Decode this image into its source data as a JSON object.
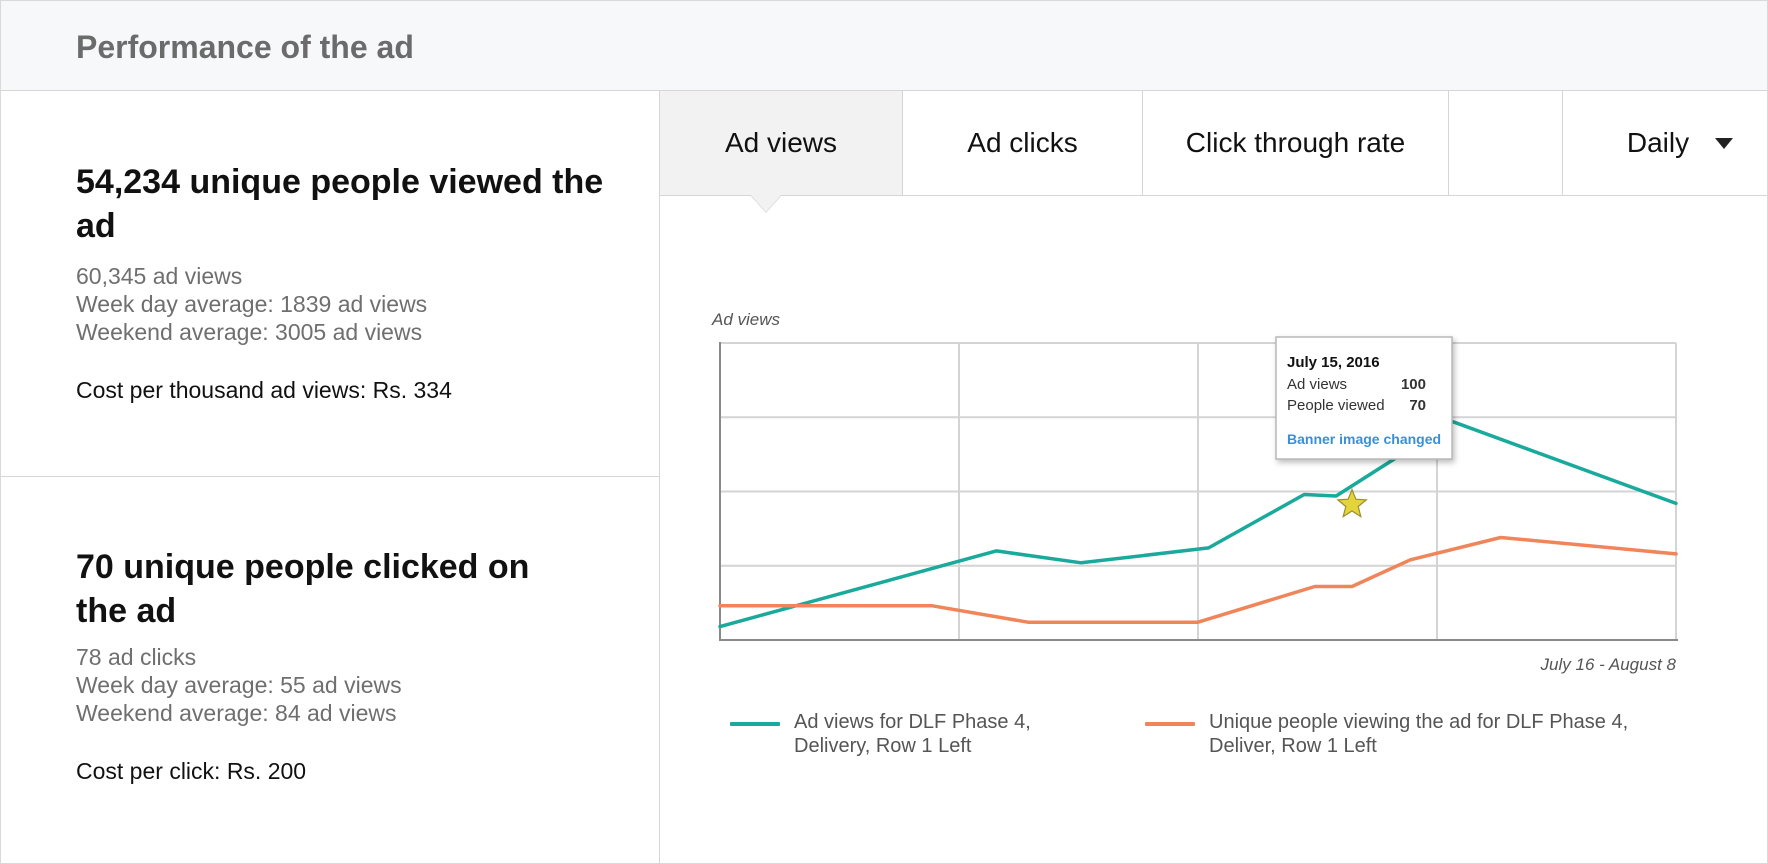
{
  "header": {
    "title": "Performance of the ad"
  },
  "views_summary": {
    "headline": "54,234 unique people viewed the ad",
    "lines": [
      "60,345 ad views",
      "Week day average: 1839 ad views",
      "Weekend average: 3005 ad views"
    ],
    "cost": "Cost per thousand ad views: Rs. 334"
  },
  "clicks_summary": {
    "headline": "70 unique people clicked on the ad",
    "lines": [
      "78 ad clicks",
      "Week day average: 55 ad views",
      "Weekend average: 84 ad views"
    ],
    "cost": "Cost per click: Rs. 200"
  },
  "tabs": [
    {
      "label": "Ad views",
      "active": true
    },
    {
      "label": "Ad clicks",
      "active": false
    },
    {
      "label": "Click through rate",
      "active": false
    },
    {
      "label": "",
      "active": false
    }
  ],
  "period_select": {
    "value": "Daily"
  },
  "colors": {
    "views": "#1aaa9c",
    "people": "#f0855a",
    "star": "#e4d43c",
    "link": "#3a8fd8"
  },
  "chart_data": {
    "type": "line",
    "ylabel": "Ad views",
    "xlabel": "July 16 - August 8",
    "x": [
      0,
      1.2,
      1.7,
      2.05,
      2.6,
      3.15,
      3.8,
      4.5,
      4.65,
      5.0,
      5.7,
      6.7,
      7.9,
      9.0
    ],
    "xlim": [
      0,
      9
    ],
    "ylim": [
      0,
      200
    ],
    "grid": true,
    "legend_position": "bottom",
    "series": [
      {
        "name": "Ad views for DLF Phase 4, Delivery, Row 1 Left",
        "color": "#1aaa9c",
        "x": [
          0,
          2.6,
          3.4,
          4.6,
          5.5,
          5.8,
          6.9,
          9.0
        ],
        "values": [
          9,
          60,
          52,
          62,
          98,
          97,
          147,
          92
        ]
      },
      {
        "name": "Unique people viewing the ad for DLF Phase 4, Deliver, Row 1 Left",
        "color": "#f0855a",
        "x": [
          0,
          2.0,
          2.9,
          4.5,
          5.6,
          5.95,
          6.5,
          7.35,
          9.0
        ],
        "values": [
          23,
          23,
          12,
          12,
          36,
          36,
          54,
          69,
          58
        ]
      }
    ],
    "annotation": {
      "x": 5.95,
      "y": 100,
      "date": "July 15, 2016",
      "rows": [
        {
          "label": "Ad views",
          "value": "100"
        },
        {
          "label": "People viewed",
          "value": "70"
        }
      ],
      "note": "Banner image changed"
    }
  }
}
